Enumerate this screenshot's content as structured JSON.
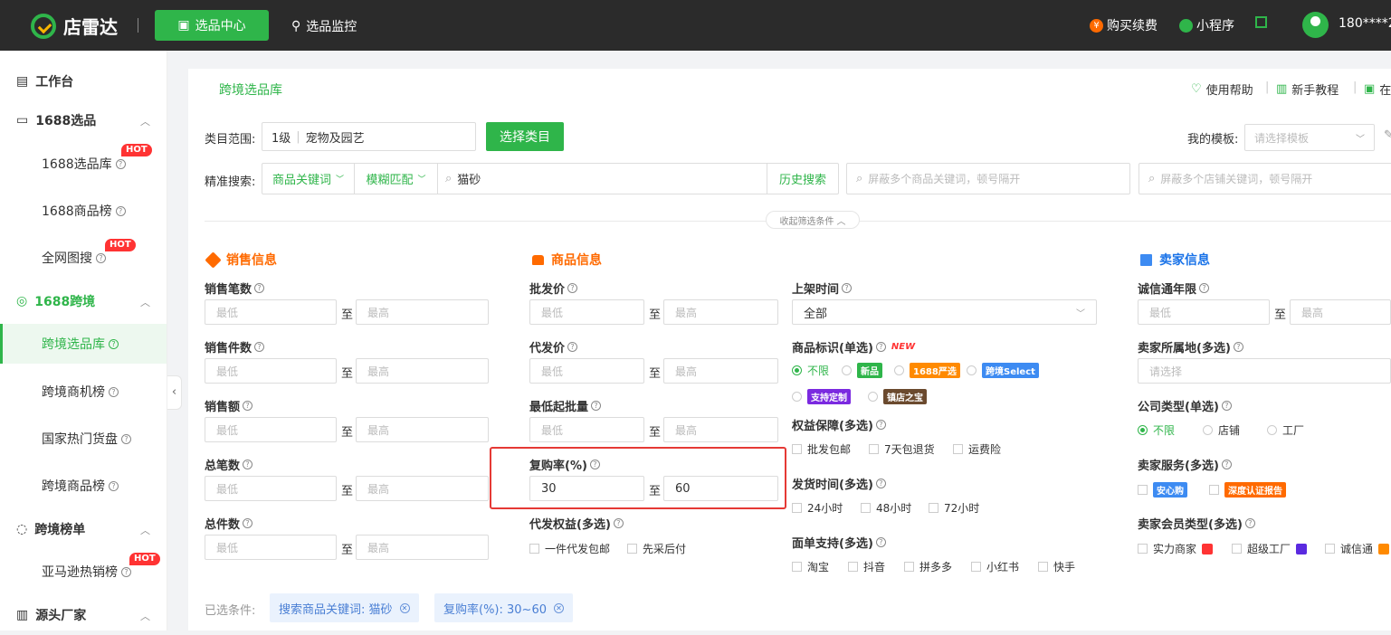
{
  "brand": {
    "name": "店雷达"
  },
  "topnav": {
    "active": "选品中心",
    "monitor": "选品监控",
    "buy": "购买续费",
    "mini": "小程序",
    "user": "180****27"
  },
  "sidebar": {
    "workbench": "工作台",
    "g1688": "1688选品",
    "i1688lib": "1688选品库",
    "i1688rank": "1688商品榜",
    "iimg": "全网图搜",
    "gcross": "1688跨境",
    "icrosslib": "跨境选品库",
    "ibiz": "跨境商机榜",
    "ihot": "国家热门货盘",
    "icrossrank": "跨境商品榜",
    "grank": "跨境榜单",
    "iamazon": "亚马逊热销榜",
    "gsource": "源头厂家",
    "hot": "HOT"
  },
  "tab": "跨境选品库",
  "help": {
    "usage": "使用帮助",
    "tutorial": "新手教程",
    "online": "在"
  },
  "filters": {
    "category_label": "类目范围:",
    "category_level": "1级",
    "category_value": "宠物及园艺",
    "choose_btn": "选择类目",
    "template_label": "我的模板:",
    "template_ph": "请选择模板",
    "search_label": "精准搜索:",
    "kw_type": "商品关键词",
    "match": "模糊匹配",
    "keyword": "猫砂",
    "history": "历史搜索",
    "block_goods_ph": "屏蔽多个商品关键词，顿号隔开",
    "block_shop_ph": "屏蔽多个店铺关键词，顿号隔开",
    "fold": "收起筛选条件"
  },
  "common": {
    "min": "最低",
    "max": "最高",
    "to": "至",
    "select_ph": "请选择"
  },
  "sales": {
    "title": "销售信息",
    "f1": "销售笔数",
    "f2": "销售件数",
    "f3": "销售额",
    "f4": "总笔数",
    "f5": "总件数"
  },
  "goods": {
    "title": "商品信息",
    "f1": "批发价",
    "f2": "代发价",
    "f3": "最低起批量",
    "f4": "复购率(%)",
    "f4_min": "30",
    "f4_max": "60",
    "f5": "代发权益(多选)",
    "o1": "一件代发包邮",
    "o2": "先采后付"
  },
  "mid": {
    "listing": "上架时间",
    "listing_val": "全部",
    "mark": "商品标识(单选)",
    "new": "NEW",
    "m_all": "不限",
    "m_new": "新品",
    "m_1688": "1688严选",
    "m_cross": "跨境Select",
    "m_custom": "支持定制",
    "m_shop": "镇店之宝",
    "rights": "权益保障(多选)",
    "r1": "批发包邮",
    "r2": "7天包退货",
    "r3": "运费险",
    "ship": "发货时间(多选)",
    "s1": "24小时",
    "s2": "48小时",
    "s3": "72小时",
    "sheet": "面单支持(多选)",
    "p1": "淘宝",
    "p2": "抖音",
    "p3": "拼多多",
    "p4": "小红书",
    "p5": "快手"
  },
  "seller": {
    "title": "卖家信息",
    "years": "诚信通年限",
    "loc": "卖家所属地(多选)",
    "ctype": "公司类型(单选)",
    "c1": "不限",
    "c2": "店铺",
    "c3": "工厂",
    "service": "卖家服务(多选)",
    "sv1": "安心购",
    "sv2": "深度认证报告",
    "member": "卖家会员类型(多选)",
    "mb1": "实力商家",
    "mb2": "超级工厂",
    "mb3": "诚信通"
  },
  "selected": {
    "label": "已选条件:",
    "c1": "搜索商品关键词:  猫砂",
    "c2": "复购率(%):  30~60"
  },
  "colors": {
    "accent": "#2fb54a",
    "orange": "#ff6a00",
    "highlight": "#e53935"
  }
}
